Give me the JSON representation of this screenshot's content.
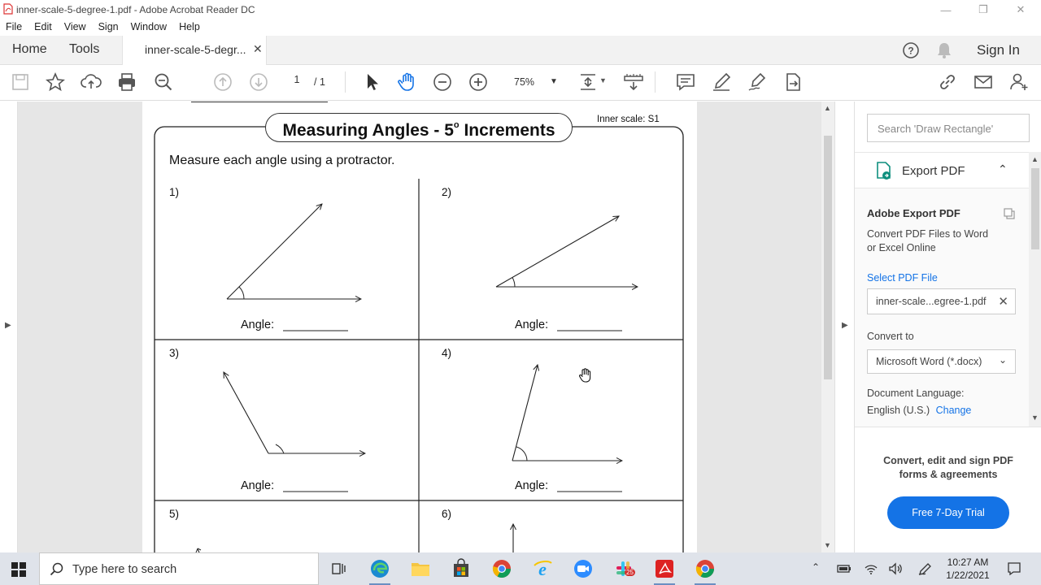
{
  "window": {
    "title": "inner-scale-5-degree-1.pdf - Adobe Acrobat Reader DC",
    "controls": [
      "minimize-icon",
      "restore-icon",
      "close-icon"
    ]
  },
  "menu": [
    "File",
    "Edit",
    "View",
    "Sign",
    "Window",
    "Help"
  ],
  "tabs": {
    "home": "Home",
    "tools": "Tools",
    "document": "inner-scale-5-degr...",
    "signin": "Sign In"
  },
  "toolbar": {
    "page_current": "1",
    "page_total": "/ 1",
    "zoom": "75%",
    "icons": [
      "save-icon",
      "bookmark-star-icon",
      "upload-icon",
      "print-icon",
      "zoom-search-icon",
      "page-up-icon",
      "page-down-icon",
      "select-arrow-icon",
      "hand-icon",
      "zoom-out-icon",
      "zoom-in-icon",
      "fit-page-icon",
      "scroll-mode-icon",
      "comment-icon",
      "highlight-pen-icon",
      "sign-icon",
      "share-file-icon",
      "link-icon",
      "mail-icon",
      "add-user-icon"
    ]
  },
  "worksheet": {
    "title_main": "Measuring Angles - 5",
    "title_sup": "o",
    "title_tail": " Increments",
    "inner_scale": "Inner scale: S1",
    "instructions": "Measure each angle using a protractor.",
    "questions": [
      {
        "num": "1)",
        "label": "Angle:"
      },
      {
        "num": "2)",
        "label": "Angle:"
      },
      {
        "num": "3)",
        "label": "Angle:"
      },
      {
        "num": "4)",
        "label": "Angle:"
      },
      {
        "num": "5)"
      },
      {
        "num": "6)"
      }
    ]
  },
  "right_pane": {
    "search_placeholder": "Search 'Draw Rectangle'",
    "export_title": "Export PDF",
    "adobe_export": "Adobe Export PDF",
    "convert_desc_1": "Convert PDF Files to Word",
    "convert_desc_2": "or Excel Online",
    "select_file": "Select PDF File",
    "file_name": "inner-scale...egree-1.pdf",
    "convert_to": "Convert to",
    "format": "Microsoft Word (*.docx)",
    "doc_language": "Document Language:",
    "language": "English (U.S.)",
    "change": "Change",
    "promo_1": "Convert, edit and sign PDF",
    "promo_2": "forms & agreements",
    "trial": "Free 7-Day Trial"
  },
  "taskbar": {
    "search_placeholder": "Type here to search",
    "time": "10:27 AM",
    "date": "1/22/2021",
    "slack_badge": "25",
    "apps": [
      "task-view-icon",
      "edge-icon",
      "file-explorer-icon",
      "store-icon",
      "chrome-icon",
      "ie-icon",
      "zoom-icon",
      "slack-icon",
      "acrobat-icon",
      "chrome-icon"
    ]
  },
  "colors": {
    "accent": "#1473e6",
    "taskbar": "#dfe3ea"
  }
}
